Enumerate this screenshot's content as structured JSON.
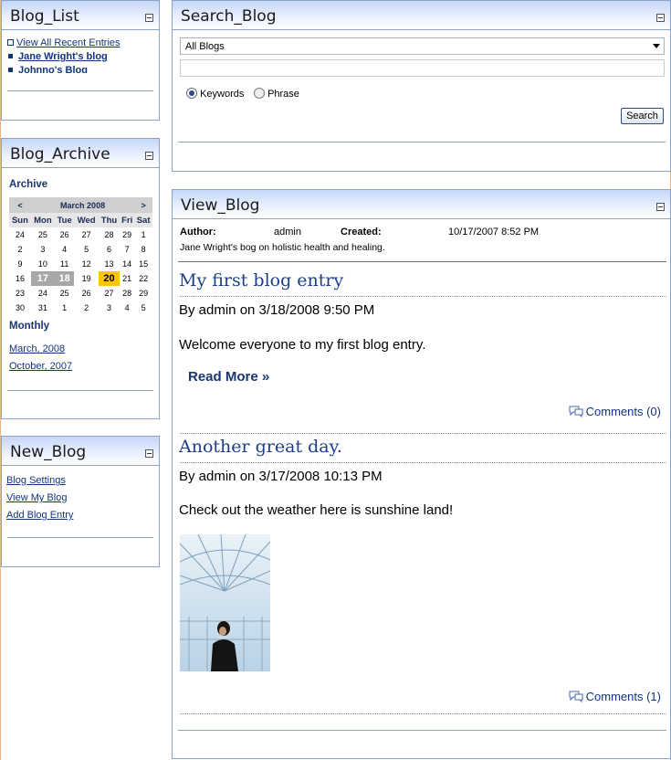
{
  "blog_list": {
    "title": "Blog_List",
    "items": [
      "View All Recent Entries",
      "Jane Wright's blog",
      "Johnno's Blog"
    ]
  },
  "blog_archive": {
    "title": "Blog_Archive",
    "archive_label": "Archive",
    "calendar": {
      "month": "March 2008",
      "prev": "<",
      "next": ">",
      "weekdays": [
        "Sun",
        "Mon",
        "Tue",
        "Wed",
        "Thu",
        "Fri",
        "Sat"
      ],
      "weeks": [
        [
          "24",
          "25",
          "26",
          "27",
          "28",
          "29",
          "1"
        ],
        [
          "2",
          "3",
          "4",
          "5",
          "6",
          "7",
          "8"
        ],
        [
          "9",
          "10",
          "11",
          "12",
          "13",
          "14",
          "15"
        ],
        [
          "16",
          "17",
          "18",
          "19",
          "20",
          "21",
          "22"
        ],
        [
          "23",
          "24",
          "25",
          "26",
          "27",
          "28",
          "29"
        ],
        [
          "30",
          "31",
          "1",
          "2",
          "3",
          "4",
          "5"
        ]
      ],
      "selected": [
        "17",
        "18"
      ],
      "today": "20"
    },
    "monthly_label": "Monthly",
    "months": [
      "March, 2008",
      "October, 2007"
    ]
  },
  "new_blog": {
    "title": "New_Blog",
    "links": [
      "Blog Settings",
      "View My Blog",
      "Add Blog Entry"
    ]
  },
  "search_blog": {
    "title": "Search_Blog",
    "scope_value": "All Blogs",
    "query_value": "",
    "options": [
      "Keywords",
      "Phrase"
    ],
    "selected_option": "Keywords",
    "search_button": "Search"
  },
  "view_blog": {
    "title": "View_Blog",
    "author_label": "Author:",
    "author": "admin",
    "created_label": "Created:",
    "created": "10/17/2007 8:52 PM",
    "description": "Jane Wright's bog on holistic health and healing.",
    "entries": [
      {
        "title": "My first blog entry",
        "byline": "By admin on 3/18/2008 9:50 PM",
        "body": "Welcome everyone to my first blog entry.",
        "read_more": "Read More »",
        "comments": "Comments (0)"
      },
      {
        "title": "Another great day.",
        "byline": "By admin on 3/17/2008 10:13 PM",
        "body": "Check out the weather here is sunshine land!",
        "comments": "Comments (1)"
      }
    ]
  },
  "colors": {
    "panel_border": "#8aa3c6",
    "link": "#12357a",
    "title_blue": "#1b3e8a",
    "today_highlight": "#ffc20e",
    "selected_day": "#a7a7a7"
  }
}
